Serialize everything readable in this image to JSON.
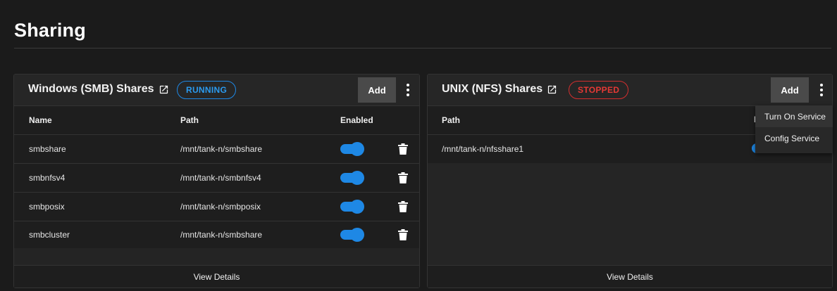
{
  "page": {
    "title": "Sharing"
  },
  "smb": {
    "title": "Windows (SMB) Shares",
    "status": "RUNNING",
    "add_label": "Add",
    "columns": {
      "name": "Name",
      "path": "Path",
      "enabled": "Enabled"
    },
    "rows": [
      {
        "name": "smbshare",
        "path": "/mnt/tank-n/smbshare",
        "enabled": true
      },
      {
        "name": "smbnfsv4",
        "path": "/mnt/tank-n/smbnfsv4",
        "enabled": true
      },
      {
        "name": "smbposix",
        "path": "/mnt/tank-n/smbposix",
        "enabled": true
      },
      {
        "name": "smbcluster",
        "path": "/mnt/tank-n/smbshare",
        "enabled": true
      }
    ],
    "footer": "View Details"
  },
  "nfs": {
    "title": "UNIX (NFS) Shares",
    "status": "STOPPED",
    "add_label": "Add",
    "columns": {
      "path": "Path",
      "enabled_peek": "E"
    },
    "rows": [
      {
        "path": "/mnt/tank-n/nfsshare1",
        "enabled": true
      }
    ],
    "footer": "View Details"
  },
  "menu": {
    "items": [
      {
        "label": "Turn On Service"
      },
      {
        "label": "Config Service"
      }
    ]
  },
  "colors": {
    "running": "#1e88e5",
    "stopped": "#d32f2f",
    "toggle_on": "#1e88e5"
  }
}
